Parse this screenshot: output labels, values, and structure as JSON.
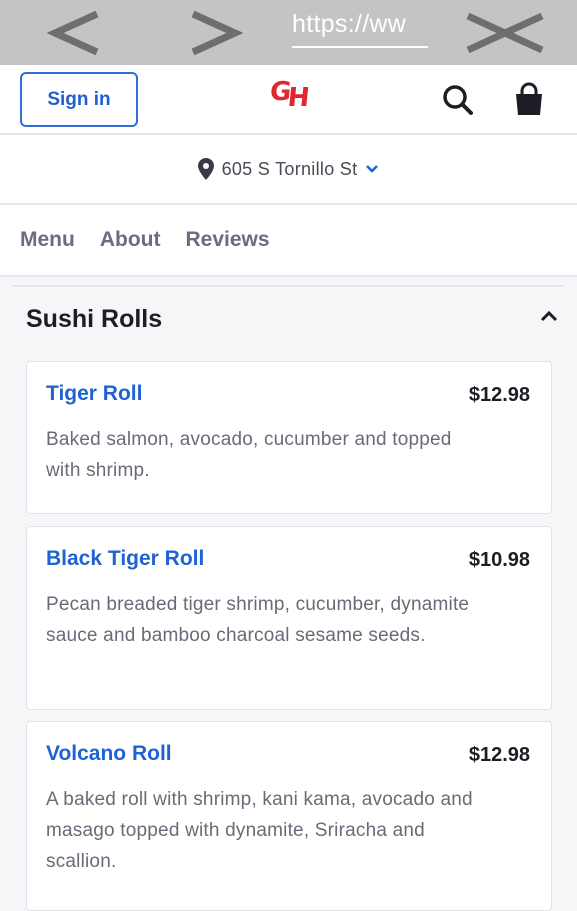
{
  "browser": {
    "url": "https://ww",
    "back_icon": "chevron-left-icon",
    "forward_icon": "chevron-right-icon",
    "close_icon": "close-icon"
  },
  "header": {
    "signin_label": "Sign in",
    "logo_text_g": "G",
    "logo_text_h": "H",
    "brand_color": "#e0262f",
    "accent_color": "#1f5fd0"
  },
  "address": {
    "text": "605 S Tornillo St"
  },
  "tabs": [
    {
      "label": "Menu"
    },
    {
      "label": "About"
    },
    {
      "label": "Reviews"
    }
  ],
  "section": {
    "title": "Sushi Rolls",
    "items": [
      {
        "name": "Tiger Roll",
        "price": "$12.98",
        "description": "Baked salmon, avocado, cucumber and topped with shrimp."
      },
      {
        "name": "Black Tiger Roll",
        "price": "$10.98",
        "description": "Pecan breaded tiger shrimp, cucumber, dynamite sauce and bamboo charcoal sesame seeds."
      },
      {
        "name": "Volcano Roll",
        "price": "$12.98",
        "description": "A baked roll with shrimp, kani kama, avocado and masago topped with dynamite, Sriracha and scallion."
      }
    ]
  }
}
